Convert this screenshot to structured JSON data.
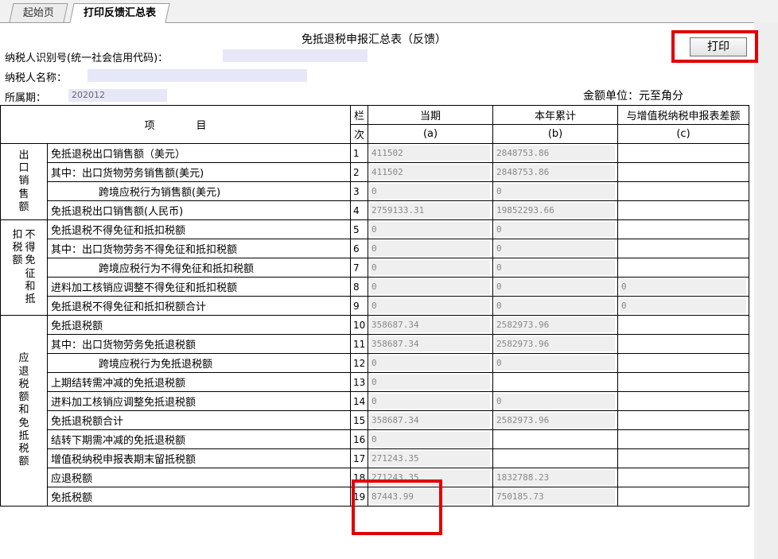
{
  "tabs": {
    "home": "起始页",
    "active": "打印反馈汇总表"
  },
  "title": "免抵退税申报汇总表（反馈）",
  "print_label": "打印",
  "taxpayer_id_label": "纳税人识别号(统一社会信用代码)：",
  "taxpayer_name_label": "纳税人名称：",
  "taxpayer_name_value": "",
  "period_label": "所属期：",
  "period_value": "202012",
  "unit_label": "金额单位：元至角分",
  "header": {
    "item_label": "项　　　　目",
    "col_no_1": "栏",
    "col_no_2": "次",
    "col_current": "当期",
    "col_ytd": "本年累计",
    "col_diff": "与增值税纳税申报表差额",
    "col_a": "(a)",
    "col_b": "(b)",
    "col_c": "(c)"
  },
  "sections": {
    "s1": "出口销售额",
    "s2a": "扣税额",
    "s2b": "不得免征和抵",
    "s3": "应退税额和免抵税额"
  },
  "rows": [
    {
      "name": "免抵退税出口销售额（美元）",
      "no": "1",
      "a": "411502",
      "b": "2848753.86",
      "c": null
    },
    {
      "name": "其中：出口货物劳务销售额(美元)",
      "no": "2",
      "a": "411502",
      "b": "2848753.86",
      "c": null
    },
    {
      "name": "跨境应税行为销售额(美元)",
      "no": "3",
      "a": "0",
      "b": "0",
      "c": null
    },
    {
      "name": "免抵退税出口销售额(人民币)",
      "no": "4",
      "a": "2759133.31",
      "b": "19852293.66",
      "c": null
    },
    {
      "name": "免抵退税不得免征和抵扣税额",
      "no": "5",
      "a": "0",
      "b": "0",
      "c": null
    },
    {
      "name": "其中：出口货物劳务不得免征和抵扣税额",
      "no": "6",
      "a": "0",
      "b": "0",
      "c": null
    },
    {
      "name": "跨境应税行为不得免征和抵扣税额",
      "no": "7",
      "a": "0",
      "b": "0",
      "c": null
    },
    {
      "name": "进料加工核销应调整不得免征和抵扣税额",
      "no": "8",
      "a": "0",
      "b": "0",
      "c": "0"
    },
    {
      "name": "免抵退税不得免征和抵扣税额合计",
      "no": "9",
      "a": "0",
      "b": "0",
      "c": "0"
    },
    {
      "name": "免抵退税额",
      "no": "10",
      "a": "358687.34",
      "b": "2582973.96",
      "c": null
    },
    {
      "name": "其中：出口货物劳务免抵退税额",
      "no": "11",
      "a": "358687.34",
      "b": "2582973.96",
      "c": null
    },
    {
      "name": "跨境应税行为免抵退税额",
      "no": "12",
      "a": "0",
      "b": "0",
      "c": null
    },
    {
      "name": "上期结转需冲减的免抵退税额",
      "no": "13",
      "a": "0",
      "b": null,
      "c": null
    },
    {
      "name": "进料加工核销应调整免抵退税额",
      "no": "14",
      "a": "0",
      "b": "0",
      "c": null
    },
    {
      "name": "免抵退税额合计",
      "no": "15",
      "a": "358687.34",
      "b": "2582973.96",
      "c": null
    },
    {
      "name": "结转下期需冲减的免抵退税额",
      "no": "16",
      "a": "0",
      "b": null,
      "c": null
    },
    {
      "name": "增值税纳税申报表期末留抵税额",
      "no": "17",
      "a": "271243.35",
      "b": null,
      "c": null
    },
    {
      "name": "应退税额",
      "no": "18",
      "a": "271243.35",
      "b": "1832788.23",
      "c": null
    },
    {
      "name": "免抵税额",
      "no": "19",
      "a": "87443.99",
      "b": "750185.73",
      "c": null
    }
  ],
  "colors": {
    "highlight": "#e00000",
    "field_bg": "#e6e8f8",
    "value_bg": "#efefef"
  }
}
